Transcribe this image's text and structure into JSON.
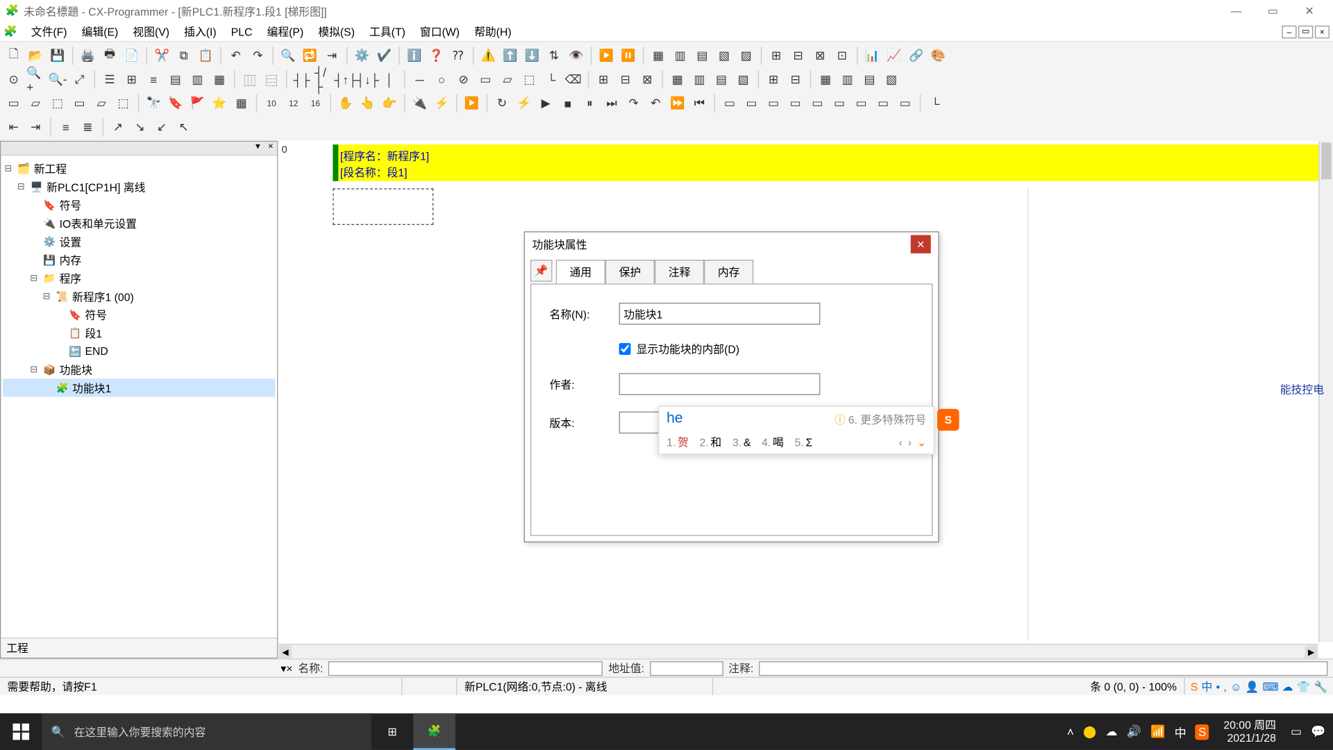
{
  "titlebar": {
    "title": "未命名標題 - CX-Programmer - [新PLC1.新程序1.段1 [梯形图]]"
  },
  "menu": {
    "file": "文件(F)",
    "edit": "编辑(E)",
    "view": "视图(V)",
    "insert": "插入(I)",
    "plc": "PLC",
    "program": "编程(P)",
    "simulate": "模拟(S)",
    "tools": "工具(T)",
    "window": "窗口(W)",
    "help": "帮助(H)"
  },
  "tree": {
    "root": "新工程",
    "plc": "新PLC1[CP1H] 离线",
    "symbols": "符号",
    "io": "IO表和单元设置",
    "settings": "设置",
    "memory": "内存",
    "programs": "程序",
    "prog1": "新程序1 (00)",
    "p_symbols": "符号",
    "sect1": "段1",
    "end": "END",
    "fb": "功能块",
    "fb1": "功能块1",
    "tab": "工程"
  },
  "ladder": {
    "row0": "0",
    "line1": "[程序名：新程序1]",
    "line2": "[段名称：段1]"
  },
  "dialog": {
    "title": "功能块属性",
    "tabs": {
      "general": "通用",
      "protect": "保护",
      "comment": "注释",
      "memory": "内存"
    },
    "name_label": "名称(N):",
    "name_value": "功能块1",
    "show_internal": "显示功能块的内部(D)",
    "author_label": "作者:",
    "author_value": "",
    "version_label": "版本:"
  },
  "ime": {
    "pinyin": "he",
    "more": "6. 更多特殊符号",
    "c1n": "1.",
    "c1": "贺",
    "c2n": "2.",
    "c2": "和",
    "c3n": "3.",
    "c3": "&",
    "c4n": "4.",
    "c4": "喝",
    "c5n": "5.",
    "c5": "Σ"
  },
  "info": {
    "name_lbl": "名称:",
    "addr_lbl": "地址值:",
    "comment_lbl": "注释:"
  },
  "status": {
    "help": "需要帮助，请按F1",
    "plc": "新PLC1(网络:0,节点:0) - 离线",
    "pos": "条 0 (0, 0) - 100%"
  },
  "watermark": {
    "l1": "电",
    "l2": "控",
    "l3": "技",
    "l4": "能"
  },
  "taskbar": {
    "search_placeholder": "在这里输入你要搜索的内容",
    "time": "20:00 周四",
    "date": "2021/1/28",
    "lang": "中"
  }
}
